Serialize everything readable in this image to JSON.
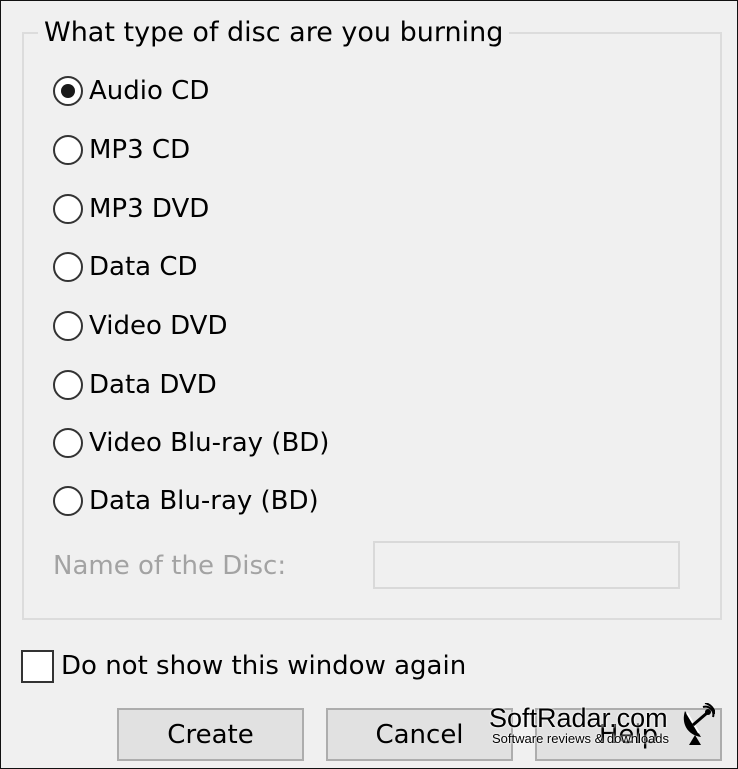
{
  "group": {
    "title": "What type of disc are you burning",
    "options": [
      {
        "label": "Audio CD",
        "checked": true
      },
      {
        "label": "MP3 CD",
        "checked": false
      },
      {
        "label": "MP3 DVD",
        "checked": false
      },
      {
        "label": "Data CD",
        "checked": false
      },
      {
        "label": "Video DVD",
        "checked": false
      },
      {
        "label": "Data DVD",
        "checked": false
      },
      {
        "label": "Video Blu-ray (BD)",
        "checked": false
      },
      {
        "label": "Data Blu-ray (BD)",
        "checked": false
      }
    ],
    "disc_name_label": "Name of the Disc:",
    "disc_name_value": ""
  },
  "dont_show": {
    "label": "Do not show this window again",
    "checked": false
  },
  "buttons": {
    "create": "Create",
    "cancel": "Cancel",
    "help": "Help"
  },
  "watermark": {
    "title": "SoftRadar.com",
    "subtitle": "Software reviews & downloads"
  },
  "colors": {
    "window_bg": "#f0f0f0",
    "button_bg": "#e1e1e1",
    "disabled_text": "#a3a3a3"
  }
}
